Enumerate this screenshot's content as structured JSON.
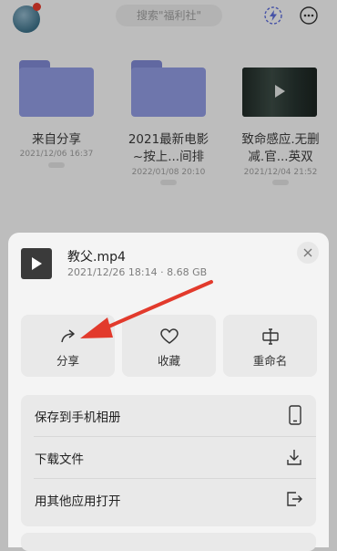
{
  "search": {
    "placeholder": "搜索\"福利社\""
  },
  "files": [
    {
      "name": "来自分享",
      "date": "2021/12/06 16:37",
      "kind": "folder"
    },
    {
      "name_line1": "2021最新电影",
      "name_line2": "~按上...间排",
      "date": "2022/01/08 20:10",
      "kind": "folder"
    },
    {
      "name_line1": "致命感应.无删",
      "name_line2": "减.官...英双",
      "date": "2021/12/04 21:52",
      "kind": "video"
    }
  ],
  "sheet": {
    "title": "教父.mp4",
    "meta": "2021/12/26 18:14 · 8.68 GB",
    "actions": [
      {
        "label": "分享",
        "icon": "share-icon"
      },
      {
        "label": "收藏",
        "icon": "heart-icon"
      },
      {
        "label": "重命名",
        "icon": "rename-icon"
      }
    ],
    "menu": [
      {
        "label": "保存到手机相册",
        "icon": "phone-icon"
      },
      {
        "label": "下载文件",
        "icon": "download-icon"
      },
      {
        "label": "用其他应用打开",
        "icon": "open-external-icon"
      }
    ]
  },
  "colors": {
    "folder": "#8e98dd",
    "arrow": "#e23a2c",
    "notification_dot": "#e23a2c"
  }
}
